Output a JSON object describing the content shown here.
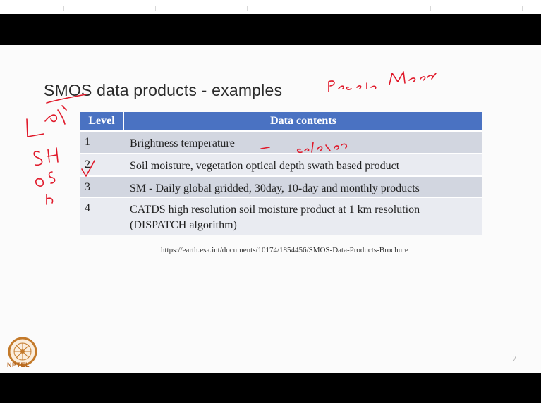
{
  "slide": {
    "title": "SMOS data products - examples",
    "table": {
      "headers": [
        "Level",
        "Data contents"
      ],
      "rows": [
        {
          "level": "1",
          "content": "Brightness temperature"
        },
        {
          "level": "2",
          "content": "Soil moisture, vegetation optical depth swath based product"
        },
        {
          "level": "3",
          "content": "SM - Daily global gridded, 30day, 10-day and monthly products"
        },
        {
          "level": "4",
          "content": "CATDS high resolution soil moisture product at 1 km resolution (DISPATCH algorithm)"
        }
      ]
    },
    "source_url": "https://earth.esa.int/documents/10174/1854456/SMOS-Data-Products-Brochure",
    "page_number": "7",
    "logo_text": "NPTEL",
    "annotations": {
      "passive_microwave": "Passive Microwave",
      "calibrated": "calibrated",
      "margin_notes": [
        "L band",
        "SM",
        "OS",
        "Ice"
      ]
    },
    "colors": {
      "header_bg": "#4a72c2",
      "row_shade": "#d2d6e0",
      "row_light": "#e9ebf1",
      "ink": "#e0192a"
    }
  }
}
